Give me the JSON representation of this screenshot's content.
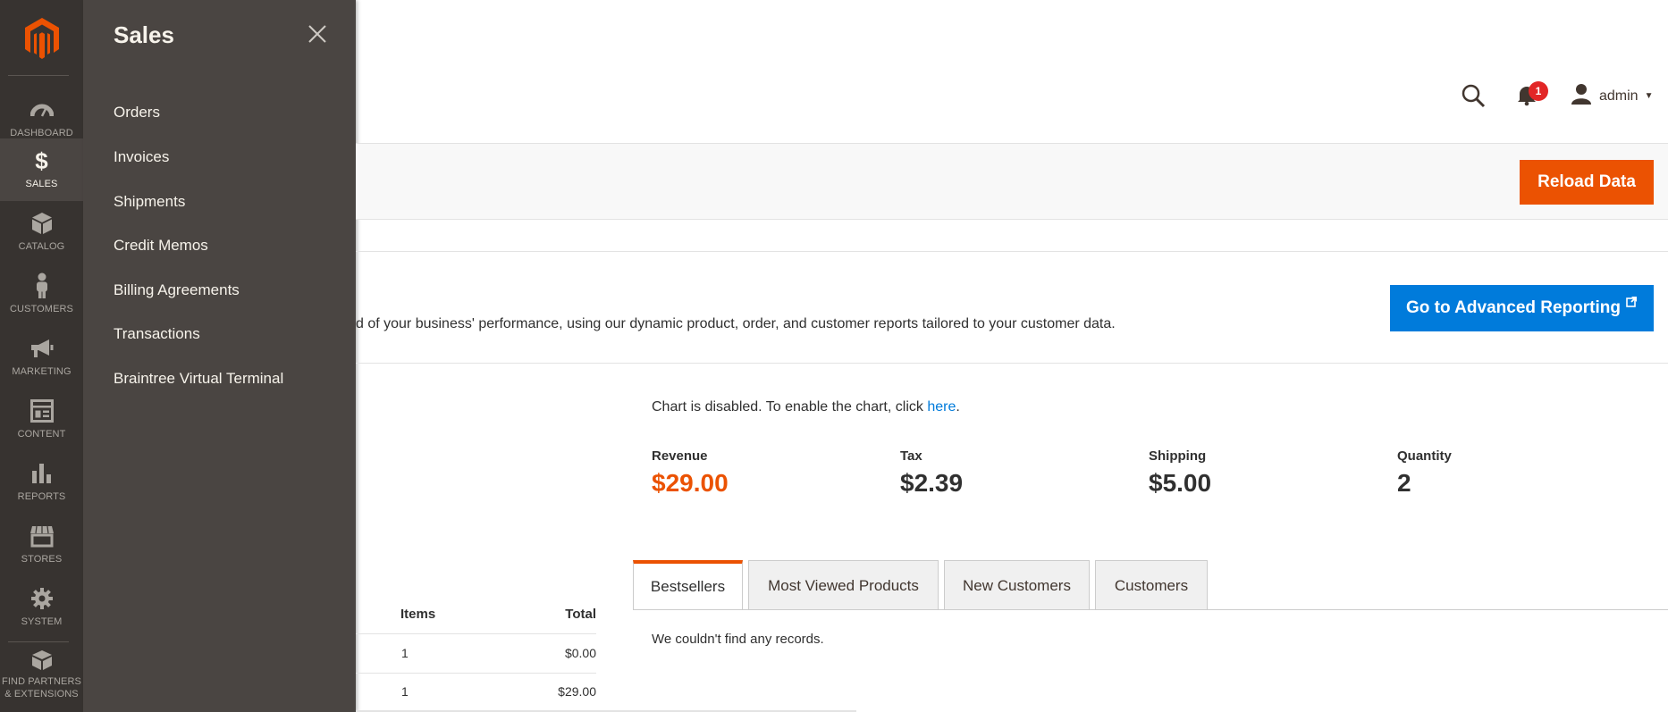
{
  "nav": {
    "items": [
      {
        "label": "DASHBOARD",
        "icon": "dashboard-icon"
      },
      {
        "label": "SALES",
        "icon": "dollar-icon"
      },
      {
        "label": "CATALOG",
        "icon": "box-icon"
      },
      {
        "label": "CUSTOMERS",
        "icon": "person-icon"
      },
      {
        "label": "MARKETING",
        "icon": "megaphone-icon"
      },
      {
        "label": "CONTENT",
        "icon": "layout-icon"
      },
      {
        "label": "REPORTS",
        "icon": "bar-chart-icon"
      },
      {
        "label": "STORES",
        "icon": "store-icon"
      },
      {
        "label": "SYSTEM",
        "icon": "gear-icon"
      }
    ],
    "partners_line1": "FIND PARTNERS",
    "partners_line2": "& EXTENSIONS",
    "accent": "#eb5202"
  },
  "flyout": {
    "title": "Sales",
    "items": [
      "Orders",
      "Invoices",
      "Shipments",
      "Credit Memos",
      "Billing Agreements",
      "Transactions",
      "Braintree Virtual Terminal"
    ]
  },
  "header": {
    "notification_count": "1",
    "username": "admin"
  },
  "actions": {
    "reload_label": "Reload Data"
  },
  "advanced": {
    "text": "d of your business' performance, using our dynamic product, order, and customer reports tailored to your customer data.",
    "button_label": "Go to Advanced Reporting"
  },
  "chart_notice": {
    "prefix": "Chart is disabled. To enable the chart, click ",
    "link": "here",
    "suffix": "."
  },
  "totals": [
    {
      "label": "Revenue",
      "value": "$29.00"
    },
    {
      "label": "Tax",
      "value": "$2.39"
    },
    {
      "label": "Shipping",
      "value": "$5.00"
    },
    {
      "label": "Quantity",
      "value": "2"
    }
  ],
  "tabs": [
    "Bestsellers",
    "Most Viewed Products",
    "New Customers",
    "Customers"
  ],
  "tab_content": "We couldn't find any records.",
  "orders_table": {
    "headers": {
      "items": "Items",
      "total": "Total"
    },
    "rows": [
      {
        "items": "1",
        "total": "$0.00"
      },
      {
        "items": "1",
        "total": "$29.00"
      }
    ]
  }
}
